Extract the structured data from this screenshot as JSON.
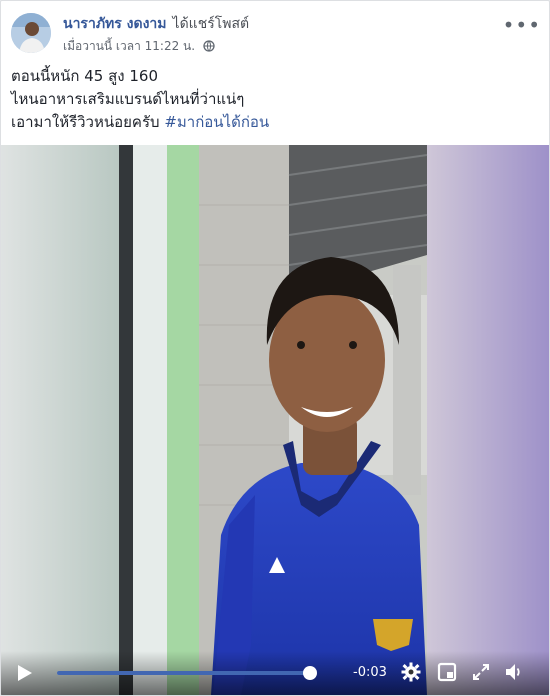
{
  "post": {
    "author": "นาราภัทร งดงาม",
    "action": "ได้แชร์โพสต์",
    "timestamp": "เมื่อวานนี้ เวลา 11:22 น.",
    "privacy_icon": "globe-icon",
    "more_icon": "more-options-icon",
    "more_label": "•••",
    "text_lines": [
      "ตอนนี้หนัก 45 สูง 160",
      "ไหนอาหารเสริมแบรนด์ไหนที่ว่าแน่ๆ",
      "เอามาให้รีวิวหน่อยครับ"
    ],
    "hashtag": "#มาก่อนได้ก่อน"
  },
  "video": {
    "time_remaining": "-0:03",
    "progress": 0.98,
    "accent_color": "#4267b2",
    "controls": [
      "play-icon",
      "settings-icon",
      "mini-player-icon",
      "fullscreen-icon",
      "volume-icon"
    ]
  }
}
